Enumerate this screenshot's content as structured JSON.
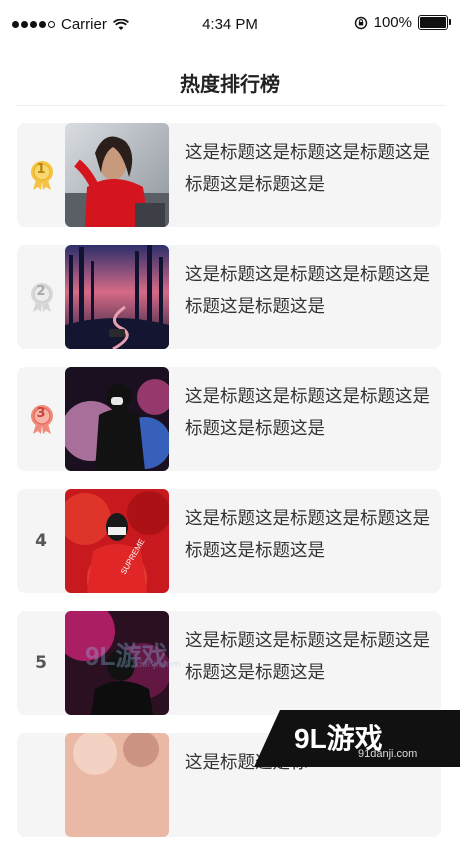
{
  "status_bar": {
    "carrier": "Carrier",
    "time": "4:34 PM",
    "battery": "100%"
  },
  "nav": {
    "title": "热度排行榜"
  },
  "list": [
    {
      "rank": "1",
      "medal": "gold",
      "title": "这是标题这是标题这是标题这是标题这是标题这是",
      "thumb": "woman-red-sweater"
    },
    {
      "rank": "2",
      "medal": "silver",
      "title": "这是标题这是标题这是标题这是标题这是标题这是",
      "thumb": "forest-road-night"
    },
    {
      "rank": "3",
      "medal": "bronze",
      "title": "这是标题这是标题这是标题这是标题这是标题这是",
      "thumb": "hooded-figure-smoke"
    },
    {
      "rank": "4",
      "medal": "",
      "title": "这是标题这是标题这是标题这是标题这是标题这是",
      "thumb": "masked-person-red-smoke"
    },
    {
      "rank": "5",
      "medal": "",
      "title": "这是标题这是标题这是标题这是标题这是标题这是",
      "thumb": "pink-smoke-dark"
    },
    {
      "rank": "",
      "medal": "",
      "title": "这是标题这是标",
      "thumb": "blurred-portrait"
    }
  ],
  "watermark": {
    "logo": "9L游戏",
    "sub": "91danji.com"
  },
  "corner_badge": {
    "logo": "9L游戏",
    "url": "91danji.com"
  },
  "colors": {
    "gold": "#f5c343",
    "silver": "#d5d5d5",
    "bronze": "#f08a7a",
    "card_bg": "#f5f5f5",
    "text": "#333333"
  }
}
